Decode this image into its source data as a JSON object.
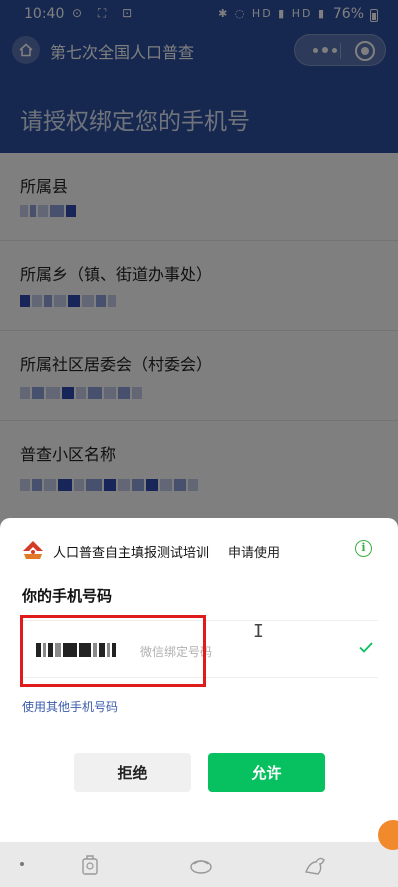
{
  "status_bar": {
    "time": "10:40",
    "battery": "76%",
    "left_icons": "⊙ ⛶ ⊡",
    "right_icons": "✱ ◌ HD ▮ HD ▮"
  },
  "nav": {
    "title": "第七次全国人口普查"
  },
  "page": {
    "heading": "请授权绑定您的手机号"
  },
  "form": {
    "fields": [
      {
        "label": "所属县"
      },
      {
        "label": "所属乡（镇、街道办事处）"
      },
      {
        "label": "所属社区居委会（村委会）"
      },
      {
        "label": "普查小区名称"
      }
    ]
  },
  "sheet": {
    "app_name": "人口普查自主填报测试培训",
    "apply_text": "申请使用",
    "info_icon": "i",
    "phone_title": "你的手机号码",
    "phone_hint": "微信绑定号码",
    "other_phone_link": "使用其他手机号码",
    "reject_label": "拒绝",
    "allow_label": "允许"
  },
  "colors": {
    "header_blue": "#2c4fa0",
    "allow_green": "#07c160",
    "highlight_red": "#e01b1b"
  }
}
